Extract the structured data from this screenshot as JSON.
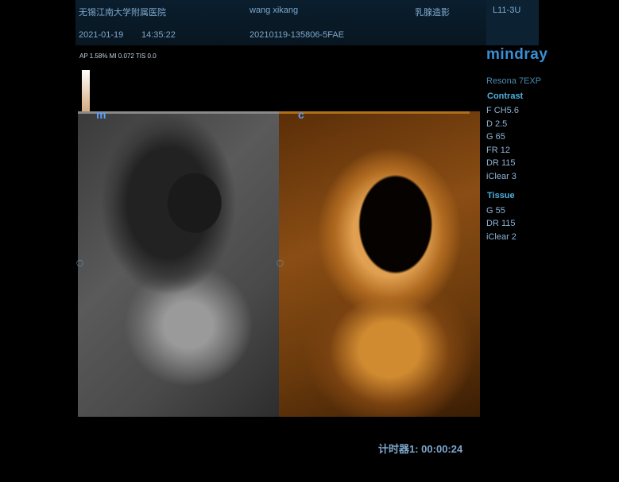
{
  "header": {
    "hospital": "无锡江南大学附属医院",
    "patient_name": "wang xikang",
    "exam_type": "乳腺造影",
    "probe": "L11-3U",
    "date": "2021-01-19",
    "time": "14:35:22",
    "exam_id": "20210119-135806-5FAE"
  },
  "status_line": "AP 1.58%  MI 0.072 TIS 0.0",
  "brand": "mindray",
  "model": "Resona 7EXP",
  "contrast": {
    "label": "Contrast",
    "params": [
      "F CH5.6",
      "D 2.5",
      "G 65",
      "FR 12",
      "DR 115",
      "iClear 3"
    ]
  },
  "tissue": {
    "label": "Tissue",
    "params": [
      "G 55",
      "DR 115",
      "iClear 2"
    ]
  },
  "markers": {
    "left": "m",
    "right": "c"
  },
  "timer": "计时器1: 00:00:24"
}
